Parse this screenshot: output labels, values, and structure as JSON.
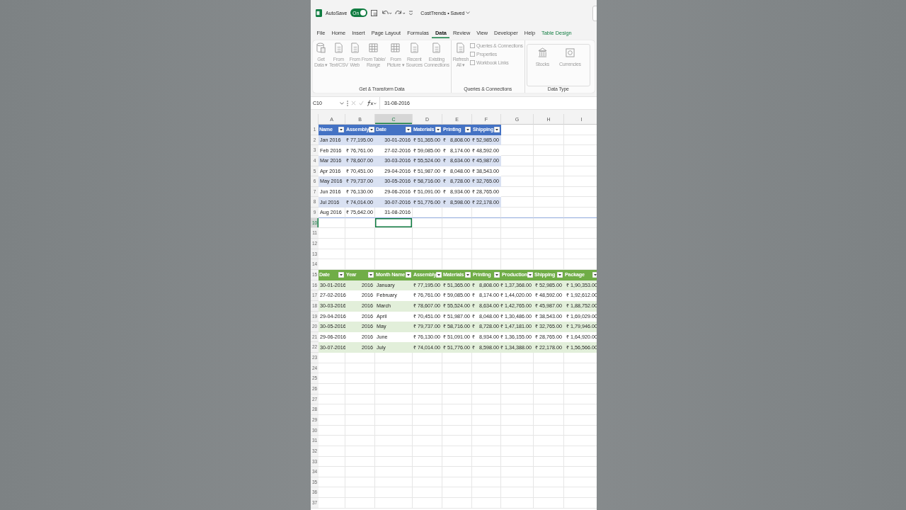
{
  "title_bar": {
    "autosave_label": "AutoSave",
    "autosave_toggle": {
      "label": "On",
      "on": true
    },
    "document_title": "CostTrends • Saved"
  },
  "tabs": [
    {
      "label": "File",
      "selected": false,
      "kind": "normal"
    },
    {
      "label": "Home",
      "selected": false,
      "kind": "normal"
    },
    {
      "label": "Insert",
      "selected": false,
      "kind": "normal"
    },
    {
      "label": "Page Layout",
      "selected": false,
      "kind": "normal"
    },
    {
      "label": "Formulas",
      "selected": false,
      "kind": "normal"
    },
    {
      "label": "Data",
      "selected": true,
      "kind": "normal"
    },
    {
      "label": "Review",
      "selected": false,
      "kind": "normal"
    },
    {
      "label": "View",
      "selected": false,
      "kind": "normal"
    },
    {
      "label": "Developer",
      "selected": false,
      "kind": "normal"
    },
    {
      "label": "Help",
      "selected": false,
      "kind": "normal"
    },
    {
      "label": "Table Design",
      "selected": false,
      "kind": "contextual"
    }
  ],
  "ribbon_groups": [
    {
      "label": "Get & Transform Data",
      "buttons": [
        {
          "lines": [
            "Get",
            "Data ▾"
          ],
          "kind": "large"
        },
        {
          "lines": [
            "From",
            "Text/CSV"
          ],
          "kind": "large"
        },
        {
          "lines": [
            "From",
            "Web"
          ],
          "kind": "large"
        },
        {
          "lines": [
            "From Table/",
            "Range"
          ],
          "kind": "large"
        },
        {
          "lines": [
            "From",
            "Picture ▾"
          ],
          "kind": "large"
        },
        {
          "lines": [
            "Recent",
            "Sources"
          ],
          "kind": "large"
        },
        {
          "lines": [
            "Existing",
            "Connections"
          ],
          "kind": "large"
        }
      ]
    },
    {
      "label": "Queries & Connections",
      "buttons": [
        {
          "lines": [
            "Refresh",
            "All ▾"
          ],
          "kind": "large"
        },
        {
          "lines": [
            "Queries & Connections"
          ],
          "kind": "small"
        },
        {
          "lines": [
            "Properties"
          ],
          "kind": "small"
        },
        {
          "lines": [
            "Workbook Links"
          ],
          "kind": "small"
        }
      ]
    },
    {
      "label": "Data Type",
      "buttons": [
        {
          "lines": [
            "Stocks"
          ],
          "kind": "gallery"
        },
        {
          "lines": [
            "Currencies"
          ],
          "kind": "gallery"
        }
      ]
    }
  ],
  "formula_bar": {
    "name_box": "C10",
    "formula": "31-08-2016"
  },
  "columns": [
    {
      "label": "A",
      "selected": false
    },
    {
      "label": "B",
      "selected": false
    },
    {
      "label": "C",
      "selected": true
    },
    {
      "label": "D",
      "selected": false
    },
    {
      "label": "E",
      "selected": false
    },
    {
      "label": "F",
      "selected": false
    },
    {
      "label": "G",
      "selected": false
    },
    {
      "label": "H",
      "selected": false
    },
    {
      "label": "I",
      "selected": false
    }
  ],
  "rows": [
    {
      "number": "1",
      "kind": "blue-header",
      "cells": [
        {
          "text": "Name",
          "kind": "header"
        },
        {
          "text": "Assembly",
          "kind": "header"
        },
        {
          "text": "Date",
          "kind": "header"
        },
        {
          "text": "Materials",
          "kind": "header"
        },
        {
          "text": "Printing",
          "kind": "header"
        },
        {
          "text": "Shipping",
          "kind": "header"
        }
      ]
    },
    {
      "number": "2",
      "kind": "blue-band",
      "cells": [
        {
          "text": "Jan 2016",
          "kind": "text"
        },
        {
          "text": "₹ 77,195.00",
          "kind": "number"
        },
        {
          "text": "30-01-2016",
          "kind": "number"
        },
        {
          "text": "₹ 51,365.00",
          "kind": "number"
        },
        {
          "text": "₹   8,808.00",
          "kind": "number"
        },
        {
          "text": "₹ 52,985.00",
          "kind": "number"
        }
      ]
    },
    {
      "number": "3",
      "kind": "blue-plain",
      "cells": [
        {
          "text": "Feb 2016",
          "kind": "text"
        },
        {
          "text": "₹ 76,761.00",
          "kind": "number"
        },
        {
          "text": "27-02-2016",
          "kind": "number"
        },
        {
          "text": "₹ 59,085.00",
          "kind": "number"
        },
        {
          "text": "₹   8,174.00",
          "kind": "number"
        },
        {
          "text": "₹ 48,592.00",
          "kind": "number"
        }
      ]
    },
    {
      "number": "4",
      "kind": "blue-band",
      "cells": [
        {
          "text": "Mar 2016",
          "kind": "text"
        },
        {
          "text": "₹ 78,607.00",
          "kind": "number"
        },
        {
          "text": "30-03-2016",
          "kind": "number"
        },
        {
          "text": "₹ 55,524.00",
          "kind": "number"
        },
        {
          "text": "₹   8,634.00",
          "kind": "number"
        },
        {
          "text": "₹ 45,987.00",
          "kind": "number"
        }
      ]
    },
    {
      "number": "5",
      "kind": "blue-plain",
      "cells": [
        {
          "text": "Apr 2016",
          "kind": "text"
        },
        {
          "text": "₹ 70,451.00",
          "kind": "number"
        },
        {
          "text": "29-04-2016",
          "kind": "number"
        },
        {
          "text": "₹ 51,987.00",
          "kind": "number"
        },
        {
          "text": "₹   8,048.00",
          "kind": "number"
        },
        {
          "text": "₹ 38,543.00",
          "kind": "number"
        }
      ]
    },
    {
      "number": "6",
      "kind": "blue-band",
      "cells": [
        {
          "text": "May 2016",
          "kind": "text"
        },
        {
          "text": "₹ 79,737.00",
          "kind": "number"
        },
        {
          "text": "30-05-2016",
          "kind": "number"
        },
        {
          "text": "₹ 58,716.00",
          "kind": "number"
        },
        {
          "text": "₹   8,728.00",
          "kind": "number"
        },
        {
          "text": "₹ 32,765.00",
          "kind": "number"
        }
      ]
    },
    {
      "number": "7",
      "kind": "blue-plain",
      "cells": [
        {
          "text": "Jun 2016",
          "kind": "text"
        },
        {
          "text": "₹ 76,130.00",
          "kind": "number"
        },
        {
          "text": "29-06-2016",
          "kind": "number"
        },
        {
          "text": "₹ 51,091.00",
          "kind": "number"
        },
        {
          "text": "₹   8,934.00",
          "kind": "number"
        },
        {
          "text": "₹ 28,765.00",
          "kind": "number"
        }
      ]
    },
    {
      "number": "8",
      "kind": "blue-band",
      "cells": [
        {
          "text": "Jul 2016",
          "kind": "text"
        },
        {
          "text": "₹ 74,014.00",
          "kind": "number"
        },
        {
          "text": "30-07-2016",
          "kind": "number"
        },
        {
          "text": "₹ 51,776.00",
          "kind": "number"
        },
        {
          "text": "₹   8,598.00",
          "kind": "number"
        },
        {
          "text": "₹ 22,178.00",
          "kind": "number"
        }
      ]
    },
    {
      "number": "9",
      "kind": "blue-last",
      "cells": [
        {
          "text": "Aug 2016",
          "kind": "text"
        },
        {
          "text": "₹ 75,642.00",
          "kind": "number"
        },
        {
          "text": "31-08-2016",
          "kind": "number"
        },
        null,
        null,
        null
      ]
    },
    {
      "number": "10",
      "kind": "plain",
      "selected": true,
      "cells": []
    },
    {
      "number": "11",
      "kind": "plain",
      "cells": []
    },
    {
      "number": "12",
      "kind": "plain",
      "cells": []
    },
    {
      "number": "13",
      "kind": "plain",
      "cells": []
    },
    {
      "number": "14",
      "kind": "plain",
      "cells": []
    },
    {
      "number": "15",
      "kind": "green-header",
      "cells": [
        {
          "text": "Date",
          "kind": "header"
        },
        {
          "text": "Year",
          "kind": "header"
        },
        {
          "text": "Month Name",
          "kind": "header"
        },
        {
          "text": "Assembly",
          "kind": "header"
        },
        {
          "text": "Materials",
          "kind": "header"
        },
        {
          "text": "Printing",
          "kind": "header"
        },
        {
          "text": "Production",
          "kind": "header"
        },
        {
          "text": "Shipping",
          "kind": "header"
        },
        {
          "text": "Package",
          "kind": "header"
        }
      ]
    },
    {
      "number": "16",
      "kind": "green-band",
      "cells": [
        {
          "text": "30-01-2016",
          "kind": "text"
        },
        {
          "text": "2016",
          "kind": "number"
        },
        {
          "text": "January",
          "kind": "text"
        },
        {
          "text": "₹ 77,195.00",
          "kind": "number"
        },
        {
          "text": "₹ 51,365.00",
          "kind": "number"
        },
        {
          "text": "₹   8,808.00",
          "kind": "number"
        },
        {
          "text": "₹ 1,37,368.00",
          "kind": "number"
        },
        {
          "text": "₹ 52,985.00",
          "kind": "number"
        },
        {
          "text": "₹ 1,90,353.00",
          "kind": "number"
        }
      ]
    },
    {
      "number": "17",
      "kind": "green-plain",
      "cells": [
        {
          "text": "27-02-2016",
          "kind": "text"
        },
        {
          "text": "2016",
          "kind": "number"
        },
        {
          "text": "February",
          "kind": "text"
        },
        {
          "text": "₹ 76,761.00",
          "kind": "number"
        },
        {
          "text": "₹ 59,085.00",
          "kind": "number"
        },
        {
          "text": "₹   8,174.00",
          "kind": "number"
        },
        {
          "text": "₹ 1,44,020.00",
          "kind": "number"
        },
        {
          "text": "₹ 48,592.00",
          "kind": "number"
        },
        {
          "text": "₹ 1,92,612.00",
          "kind": "number"
        }
      ]
    },
    {
      "number": "18",
      "kind": "green-band",
      "cells": [
        {
          "text": "30-03-2016",
          "kind": "text"
        },
        {
          "text": "2016",
          "kind": "number"
        },
        {
          "text": "March",
          "kind": "text"
        },
        {
          "text": "₹ 78,607.00",
          "kind": "number"
        },
        {
          "text": "₹ 55,524.00",
          "kind": "number"
        },
        {
          "text": "₹   8,634.00",
          "kind": "number"
        },
        {
          "text": "₹ 1,42,765.00",
          "kind": "number"
        },
        {
          "text": "₹ 45,987.00",
          "kind": "number"
        },
        {
          "text": "₹ 1,88,752.00",
          "kind": "number"
        }
      ]
    },
    {
      "number": "19",
      "kind": "green-plain",
      "cells": [
        {
          "text": "29-04-2016",
          "kind": "text"
        },
        {
          "text": "2016",
          "kind": "number"
        },
        {
          "text": "April",
          "kind": "text"
        },
        {
          "text": "₹ 70,451.00",
          "kind": "number"
        },
        {
          "text": "₹ 51,987.00",
          "kind": "number"
        },
        {
          "text": "₹   8,048.00",
          "kind": "number"
        },
        {
          "text": "₹ 1,30,486.00",
          "kind": "number"
        },
        {
          "text": "₹ 38,543.00",
          "kind": "number"
        },
        {
          "text": "₹ 1,69,029.00",
          "kind": "number"
        }
      ]
    },
    {
      "number": "20",
      "kind": "green-band",
      "cells": [
        {
          "text": "30-05-2016",
          "kind": "text"
        },
        {
          "text": "2016",
          "kind": "number"
        },
        {
          "text": "May",
          "kind": "text"
        },
        {
          "text": "₹ 79,737.00",
          "kind": "number"
        },
        {
          "text": "₹ 58,716.00",
          "kind": "number"
        },
        {
          "text": "₹   8,728.00",
          "kind": "number"
        },
        {
          "text": "₹ 1,47,181.00",
          "kind": "number"
        },
        {
          "text": "₹ 32,765.00",
          "kind": "number"
        },
        {
          "text": "₹ 1,79,946.00",
          "kind": "number"
        }
      ]
    },
    {
      "number": "21",
      "kind": "green-plain",
      "cells": [
        {
          "text": "29-06-2016",
          "kind": "text"
        },
        {
          "text": "2016",
          "kind": "number"
        },
        {
          "text": "June",
          "kind": "text"
        },
        {
          "text": "₹ 76,130.00",
          "kind": "number"
        },
        {
          "text": "₹ 51,091.00",
          "kind": "number"
        },
        {
          "text": "₹   8,934.00",
          "kind": "number"
        },
        {
          "text": "₹ 1,36,155.00",
          "kind": "number"
        },
        {
          "text": "₹ 28,765.00",
          "kind": "number"
        },
        {
          "text": "₹ 1,64,920.00",
          "kind": "number"
        }
      ]
    },
    {
      "number": "22",
      "kind": "green-band",
      "cells": [
        {
          "text": "30-07-2016",
          "kind": "text"
        },
        {
          "text": "2016",
          "kind": "number"
        },
        {
          "text": "July",
          "kind": "text"
        },
        {
          "text": "₹ 74,014.00",
          "kind": "number"
        },
        {
          "text": "₹ 51,776.00",
          "kind": "number"
        },
        {
          "text": "₹   8,598.00",
          "kind": "number"
        },
        {
          "text": "₹ 1,34,388.00",
          "kind": "number"
        },
        {
          "text": "₹ 22,178.00",
          "kind": "number"
        },
        {
          "text": "₹ 1,56,566.00",
          "kind": "number"
        }
      ]
    },
    {
      "number": "23",
      "kind": "plain",
      "cells": []
    },
    {
      "number": "24",
      "kind": "plain",
      "cells": []
    },
    {
      "number": "25",
      "kind": "plain",
      "cells": []
    },
    {
      "number": "26",
      "kind": "plain",
      "cells": []
    },
    {
      "number": "27",
      "kind": "plain",
      "cells": []
    },
    {
      "number": "28",
      "kind": "plain",
      "cells": []
    },
    {
      "number": "29",
      "kind": "plain",
      "cells": []
    },
    {
      "number": "30",
      "kind": "plain",
      "cells": []
    },
    {
      "number": "31",
      "kind": "plain",
      "cells": []
    },
    {
      "number": "32",
      "kind": "plain",
      "cells": []
    },
    {
      "number": "33",
      "kind": "plain",
      "cells": []
    },
    {
      "number": "34",
      "kind": "plain",
      "cells": []
    },
    {
      "number": "35",
      "kind": "plain",
      "cells": []
    },
    {
      "number": "36",
      "kind": "plain",
      "cells": []
    },
    {
      "number": "37",
      "kind": "plain",
      "cells": []
    }
  ]
}
